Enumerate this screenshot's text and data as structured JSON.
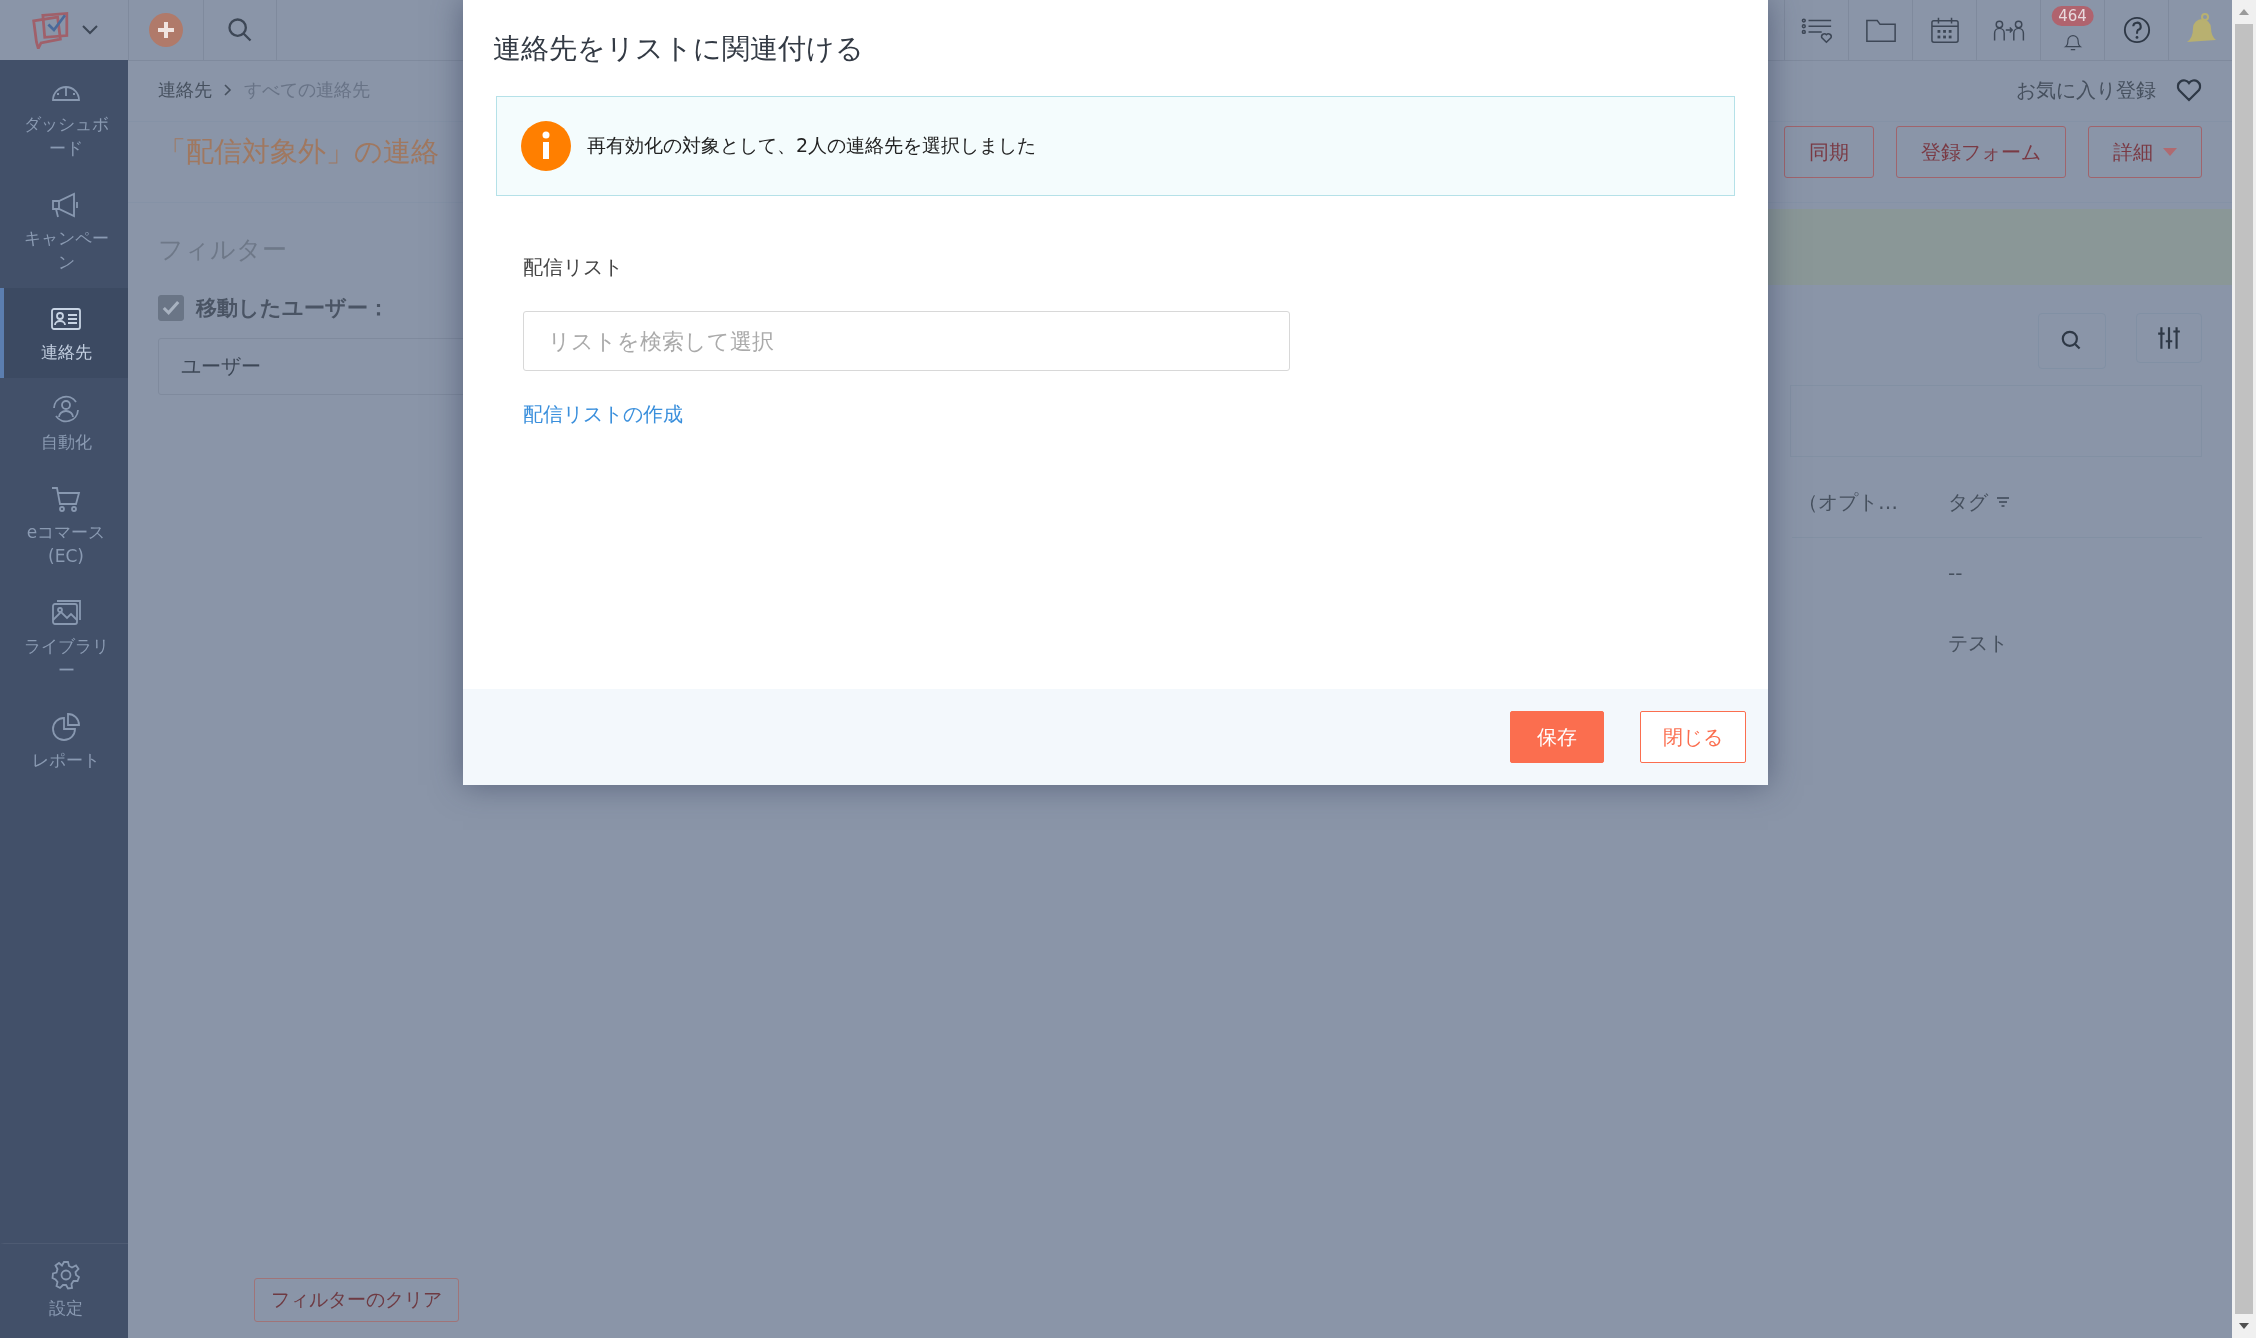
{
  "topbar": {
    "notification_count": "464"
  },
  "sidebar": {
    "items": [
      {
        "label": "ダッシュボード",
        "selected": false
      },
      {
        "label": "キャンペーン",
        "selected": false
      },
      {
        "label": "連絡先",
        "selected": true
      },
      {
        "label": "自動化",
        "selected": false
      },
      {
        "label": "eコマース(EC)",
        "selected": false
      },
      {
        "label": "ライブラリー",
        "selected": false
      },
      {
        "label": "レポート",
        "selected": false
      }
    ],
    "footer_item": {
      "label": "設定"
    }
  },
  "breadcrumb": [
    "連絡先",
    "すべての連絡先"
  ],
  "favorite": {
    "label": "お気に入り登録"
  },
  "page_title": "「配信対象外」の連絡",
  "actions": [
    {
      "label": "同期",
      "dropdown": false
    },
    {
      "label": "登録フォーム",
      "dropdown": false
    },
    {
      "label": "詳細",
      "dropdown": true
    }
  ],
  "filter": {
    "title": "フィルター",
    "option": {
      "label": "移動したユーザー：",
      "checked": true
    },
    "field_value": "ユーザー",
    "clear_button": "フィルターのクリア"
  },
  "table": {
    "columns": [
      "（オプト…",
      "タグ"
    ],
    "rows": [
      {
        "tag": "--"
      },
      {
        "tag": "テスト"
      }
    ]
  },
  "dialog": {
    "title": "連絡先をリストに関連付ける",
    "info": "再有効化の対象として、2人の連絡先を選択しました",
    "field_label": "配信リスト",
    "placeholder": "リストを検索して選択",
    "link": "配信リストの作成",
    "buttons": [
      {
        "label": "保存",
        "kind": "primary"
      },
      {
        "label": "閉じる",
        "kind": "secondary"
      }
    ]
  }
}
